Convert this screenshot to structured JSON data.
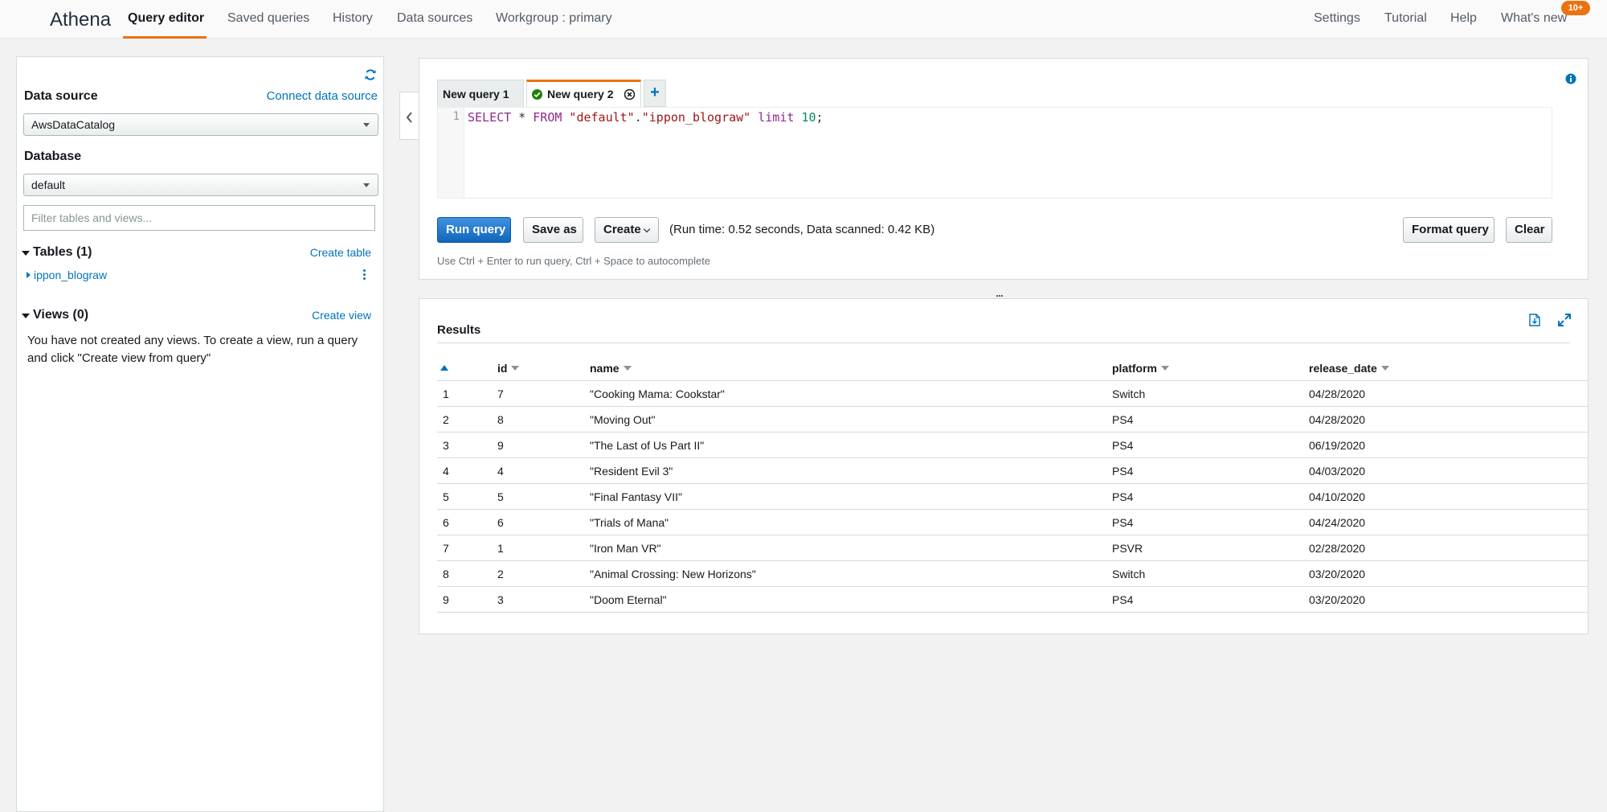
{
  "nav": {
    "brand": "Athena",
    "items": [
      "Query editor",
      "Saved queries",
      "History",
      "Data sources",
      "Workgroup : primary"
    ],
    "right_items": [
      "Settings",
      "Tutorial",
      "Help",
      "What's new"
    ],
    "badge": "10+"
  },
  "sidebar": {
    "data_source_label": "Data source",
    "connect_link": "Connect data source",
    "data_source_value": "AwsDataCatalog",
    "database_label": "Database",
    "database_value": "default",
    "filter_placeholder": "Filter tables and views...",
    "tables_header": "Tables (1)",
    "create_table_link": "Create table",
    "tables": [
      "ippon_blograw"
    ],
    "views_header": "Views (0)",
    "create_view_link": "Create view",
    "views_message": "You have not created any views. To create a view, run a query and click \"Create view from query\""
  },
  "editor": {
    "tabs": [
      "New query 1",
      "New query 2"
    ],
    "add_tab": "+",
    "line_number": "1",
    "sql": {
      "select": "SELECT",
      "star": " * ",
      "from": "FROM",
      "db": " \"default\"",
      "dot": ".",
      "table": "\"ippon_blograw\"",
      "limit": " limit ",
      "limit_value": "10",
      "end": ";"
    },
    "run_button": "Run query",
    "save_as_button": "Save as",
    "create_button": "Create",
    "run_info": "(Run time: 0.52 seconds, Data scanned: 0.42 KB)",
    "format_button": "Format query",
    "clear_button": "Clear",
    "hint": "Use Ctrl + Enter to run query, Ctrl + Space to autocomplete"
  },
  "results": {
    "title": "Results",
    "columns": [
      "id",
      "name",
      "platform",
      "release_date"
    ],
    "rows": [
      {
        "n": "1",
        "id": "7",
        "name": "\"Cooking Mama: Cookstar\"",
        "platform": "Switch",
        "release_date": "04/28/2020"
      },
      {
        "n": "2",
        "id": "8",
        "name": "\"Moving Out\"",
        "platform": "PS4",
        "release_date": "04/28/2020"
      },
      {
        "n": "3",
        "id": "9",
        "name": "\"The Last of Us Part II\"",
        "platform": "PS4",
        "release_date": "06/19/2020"
      },
      {
        "n": "4",
        "id": "4",
        "name": "\"Resident Evil 3\"",
        "platform": "PS4",
        "release_date": "04/03/2020"
      },
      {
        "n": "5",
        "id": "5",
        "name": "\"Final Fantasy VII\"",
        "platform": "PS4",
        "release_date": "04/10/2020"
      },
      {
        "n": "6",
        "id": "6",
        "name": "\"Trials of Mana\"",
        "platform": "PS4",
        "release_date": "04/24/2020"
      },
      {
        "n": "7",
        "id": "1",
        "name": "\"Iron Man VR\"",
        "platform": "PSVR",
        "release_date": "02/28/2020"
      },
      {
        "n": "8",
        "id": "2",
        "name": "\"Animal Crossing: New Horizons\"",
        "platform": "Switch",
        "release_date": "03/20/2020"
      },
      {
        "n": "9",
        "id": "3",
        "name": "\"Doom Eternal\"",
        "platform": "PS4",
        "release_date": "03/20/2020"
      }
    ]
  },
  "icons": [
    "refresh-icon",
    "chevron-left-icon",
    "info-icon",
    "check-circle-icon",
    "close-tab-icon",
    "download-icon",
    "expand-icon",
    "kebab-menu-icon"
  ],
  "colors": {
    "accent": "#ec7211",
    "link": "#0073bb",
    "primary_button": "#1166bb",
    "success": "#1d8102"
  }
}
